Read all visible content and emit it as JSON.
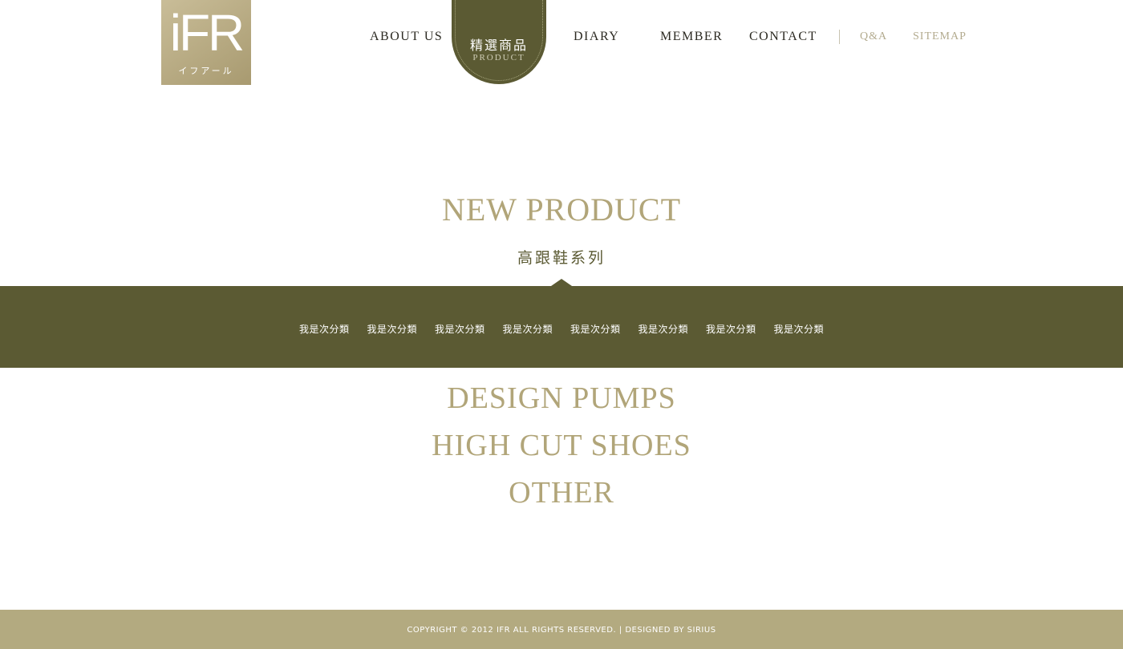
{
  "logo": {
    "mark": "iFR",
    "sub": "イフアール"
  },
  "nav": {
    "about": "ABOUT US",
    "active_zh": "精選商品",
    "active_en": "PRODUCT",
    "diary": "DIARY",
    "member": "MEMBER",
    "contact": "CONTACT",
    "qa": "Q&A",
    "sitemap": "SITEMAP"
  },
  "section": {
    "title": "NEW PRODUCT",
    "subtitle": "高跟鞋系列"
  },
  "subcategories": [
    "我是次分類",
    "我是次分類",
    "我是次分類",
    "我是次分類",
    "我是次分類",
    "我是次分類",
    "我是次分類",
    "我是次分類"
  ],
  "product_lines": [
    "DESIGN PUMPS",
    "HIGH CUT SHOES",
    "OTHER"
  ],
  "footer": {
    "text": "COPYRIGHT © 2012 IFR  ALL RIGHTS RESERVED. | DESIGNED BY SIRIUS"
  },
  "colors": {
    "brand_olive": "#5b5a33",
    "accent_gold": "#b1a579",
    "footer_bg": "#b3aa80"
  }
}
